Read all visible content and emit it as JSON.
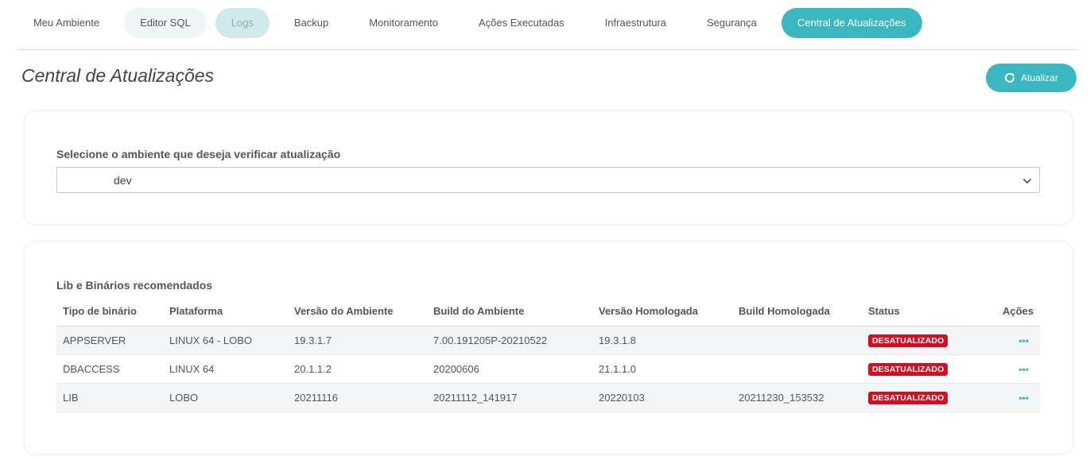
{
  "tabs": [
    {
      "label": "Meu Ambiente"
    },
    {
      "label": "Editor SQL"
    },
    {
      "label": "Logs"
    },
    {
      "label": "Backup"
    },
    {
      "label": "Monitoramento"
    },
    {
      "label": "Ações Executadas"
    },
    {
      "label": "Infraestrutura"
    },
    {
      "label": "Segurança"
    },
    {
      "label": "Central de Atualizações"
    }
  ],
  "header": {
    "title": "Central de Atualizações",
    "refresh_label": "Atualizar"
  },
  "env": {
    "label": "Selecione o ambiente que deseja verificar atualização",
    "selected": "dev"
  },
  "libs": {
    "title": "Lib e Binários recomendados",
    "columns": [
      "Tipo de binário",
      "Plataforma",
      "Versão do Ambiente",
      "Build do Ambiente",
      "Versão Homologada",
      "Build Homologada",
      "Status",
      "Ações"
    ],
    "rows": [
      {
        "tipo": "APPSERVER",
        "plataforma": "LINUX 64 - LOBO",
        "versao_amb": "19.3.1.7",
        "build_amb": "7.00.191205P-20210522",
        "versao_hom": "19.3.1.8",
        "build_hom": "",
        "status": "DESATUALIZADO"
      },
      {
        "tipo": "DBACCESS",
        "plataforma": "LINUX 64",
        "versao_amb": "20.1.1.2",
        "build_amb": "20200606",
        "versao_hom": "21.1.1.0",
        "build_hom": "",
        "status": "DESATUALIZADO"
      },
      {
        "tipo": "LIB",
        "plataforma": "LOBO",
        "versao_amb": "20211116",
        "build_amb": "20211112_141917",
        "versao_hom": "20220103",
        "build_hom": "20211230_153532",
        "status": "DESATUALIZADO"
      }
    ],
    "actions_glyph": "•••"
  },
  "colors": {
    "accent": "#3ab7c1",
    "status_danger": "#d40f23"
  }
}
